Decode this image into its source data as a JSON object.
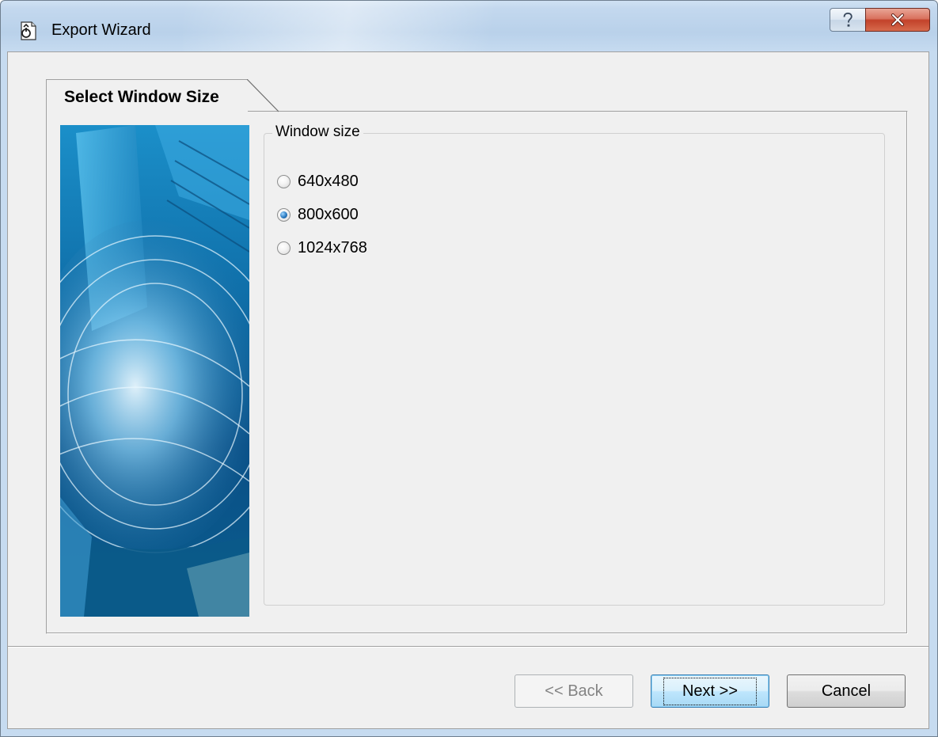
{
  "window": {
    "title": "Export Wizard",
    "help_icon": "question-mark-icon",
    "close_icon": "close-x-icon"
  },
  "wizard": {
    "tab_label": "Select Window Size",
    "group_label": "Window size",
    "options": [
      {
        "label": "640x480",
        "checked": false
      },
      {
        "label": "800x600",
        "checked": true
      },
      {
        "label": "1024x768",
        "checked": false
      }
    ]
  },
  "buttons": {
    "back_label": "<< Back",
    "next_label": "Next >>",
    "cancel_label": "Cancel"
  },
  "colors": {
    "client_bg": "#f0f0f0",
    "close_button": "#c2412a",
    "default_button_border": "#3c7fb1"
  }
}
